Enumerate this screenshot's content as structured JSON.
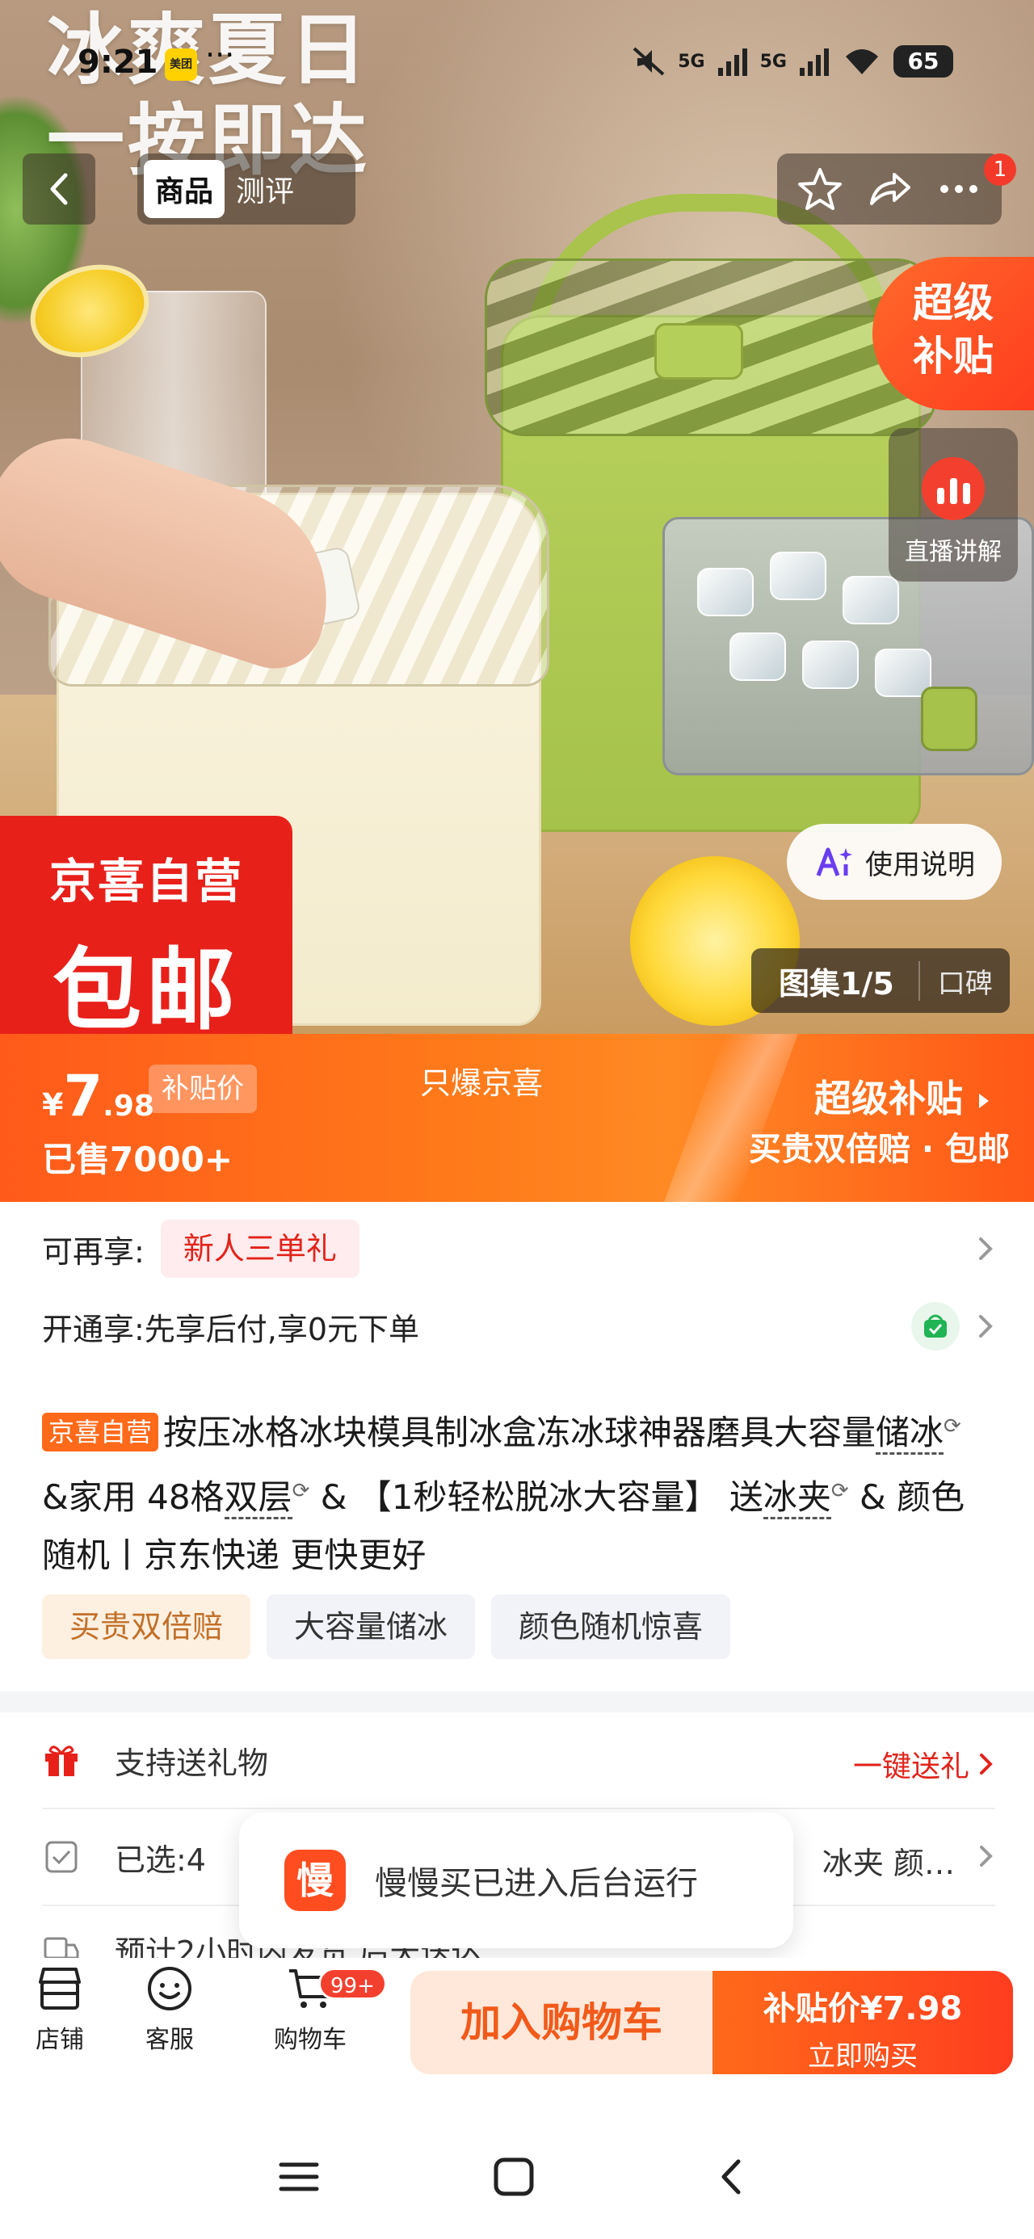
{
  "status_bar": {
    "time": "9:21",
    "app_badge": "美团",
    "dots": "···",
    "network_1": "5G",
    "network_2": "5G",
    "battery": "65"
  },
  "hero": {
    "slogan_line1": "冰爽夏日",
    "slogan_line2": "一按即达",
    "super_subsidy_line1": "超级",
    "super_subsidy_line2": "补贴",
    "live_label": "直播讲解",
    "jx_line1": "京喜自营",
    "jx_line2": "包邮",
    "usage_label": "使用说明",
    "gallery_label": "图集1/5",
    "reviews_label": "口碑"
  },
  "nav": {
    "tabs": [
      {
        "label": "商品",
        "active": true
      },
      {
        "label": "测评",
        "active": false
      }
    ],
    "notification_count": "1"
  },
  "price": {
    "currency": "¥",
    "integer": "7",
    "decimal": ".98",
    "tag": "补贴价",
    "sold": "已售7000+",
    "only_text": "只爆京喜",
    "super_subsidy": "超级补贴",
    "promise": "买贵双倍赔 · 包邮"
  },
  "benefits": {
    "row1_label": "可再享:",
    "row1_pill": "新人三单礼",
    "row2_text": "开通享:先享后付,享0元下单"
  },
  "title": {
    "tag": "京喜自营",
    "part1": "按压冰格冰块模具制冰盒冻冰球神器磨具大容量",
    "part2": "储冰",
    "part3": " &家用 48格",
    "part4": "双层",
    "part5": " & 【1秒轻松脱冰大容量】 送",
    "part6": "冰夹",
    "part7": " & 颜色随机丨京东快递 更快更好",
    "search_mark": "⟳"
  },
  "chips": [
    "买贵双倍赔",
    "大容量储冰",
    "颜色随机惊喜"
  ],
  "services": {
    "gift_label": "支持送礼物",
    "gift_action": "一键送礼",
    "selected_label": "已选:4",
    "selected_tail": "冰夹 颜…",
    "delivery_label": "预计2小时内发货,后天送达"
  },
  "toast": {
    "logo": "慢",
    "text": "慢慢买已进入后台运行"
  },
  "action_bar": {
    "store": "店铺",
    "service": "客服",
    "cart": "购物车",
    "cart_badge": "99+",
    "add_to_cart": "加入购物车",
    "buy_price": "补贴价¥7.98",
    "buy_now": "立即购买"
  },
  "colors": {
    "brand_orange": "#ff5a1a",
    "brand_red": "#e8201a"
  }
}
